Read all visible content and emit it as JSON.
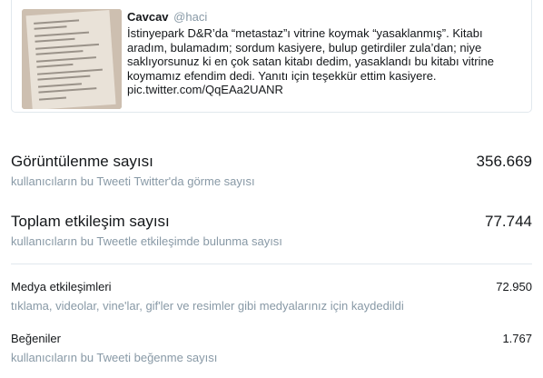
{
  "tweet": {
    "author_name": "Cavcav",
    "author_handle": "@haci",
    "text": "İstinyepark D&R’da “metastaz”ı vitrine koymak “yasaklanmış”. Kitabı aradım, bulamadım; sordum kasiyere, bulup getirdiler zula’dan; niye saklıyorsunuz ki en çok satan kitabı dedim, yasaklandı bu kitabı vitrine koymamız efendim dedi. Yanıtı için teşekkür ettim kasiyere.",
    "link": "pic.twitter.com/QqEAa2UANR"
  },
  "metrics": {
    "impressions": {
      "title": "Görüntülenme sayısı",
      "value": "356.669",
      "description": "kullanıcıların bu Tweeti Twitter'da görme sayısı"
    },
    "engagements": {
      "title": "Toplam etkileşim sayısı",
      "value": "77.744",
      "description": "kullanıcıların bu Tweetle etkileşimde bulunma sayısı"
    },
    "media": {
      "title": "Medya etkileşimleri",
      "value": "72.950",
      "description": "tıklama, videolar, vine'lar, gif'ler ve resimler gibi medyalarınız için kaydedildi"
    },
    "likes": {
      "title": "Beğeniler",
      "value": "1.767",
      "description": "kullanıcıların bu Tweeti beğenme sayısı"
    }
  }
}
